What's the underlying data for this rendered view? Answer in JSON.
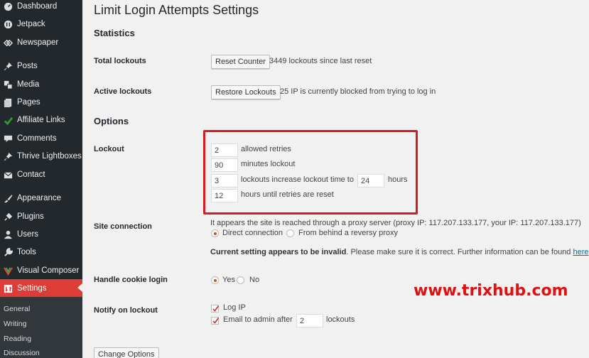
{
  "sidebar": {
    "items": [
      {
        "label": "Dashboard",
        "icon": "dashboard-icon"
      },
      {
        "label": "Jetpack",
        "icon": "jetpack-icon"
      },
      {
        "label": "Newspaper",
        "icon": "newspaper-icon"
      },
      {
        "label": "Posts",
        "icon": "pin-icon"
      },
      {
        "label": "Media",
        "icon": "media-icon"
      },
      {
        "label": "Pages",
        "icon": "pages-icon"
      },
      {
        "label": "Affiliate Links",
        "icon": "affiliate-icon"
      },
      {
        "label": "Comments",
        "icon": "comment-icon"
      },
      {
        "label": "Thrive Lightboxes",
        "icon": "pin-icon"
      },
      {
        "label": "Contact",
        "icon": "envelope-icon"
      },
      {
        "label": "Appearance",
        "icon": "paintbrush-icon"
      },
      {
        "label": "Plugins",
        "icon": "plug-icon"
      },
      {
        "label": "Users",
        "icon": "user-icon"
      },
      {
        "label": "Tools",
        "icon": "wrench-icon"
      },
      {
        "label": "Visual Composer",
        "icon": "visual-composer-icon"
      },
      {
        "label": "Settings",
        "icon": "settings-icon",
        "active": true
      }
    ],
    "submenu": [
      "General",
      "Writing",
      "Reading",
      "Discussion"
    ],
    "active_color": "#dd3d36"
  },
  "page": {
    "title": "Limit Login Attempts Settings",
    "statistics_heading": "Statistics",
    "options_heading": "Options"
  },
  "statistics": {
    "total_lockouts_label": "Total lockouts",
    "reset_button": "Reset Counter",
    "total_lockouts_text": "3449 lockouts since last reset",
    "active_lockouts_label": "Active lockouts",
    "restore_button": "Restore Lockouts",
    "active_lockouts_text": "25 IP is currently blocked from trying to log in"
  },
  "lockout": {
    "label": "Lockout",
    "allowed_retries": "2",
    "allowed_retries_text": "allowed retries",
    "minutes_lockout": "90",
    "minutes_lockout_text": "minutes lockout",
    "lockouts_increase": "3",
    "lockouts_increase_text": "lockouts increase lockout time to",
    "increase_hours": "24",
    "hours_text": "hours",
    "reset_hours": "12",
    "reset_hours_text": "hours until retries are reset",
    "highlight_color": "#d71920"
  },
  "site_connection": {
    "label": "Site connection",
    "info": "It appears the site is reached through a proxy server (proxy IP: 117.207.133.177, your IP: 117.207.133.177)",
    "option_direct": "Direct connection",
    "option_proxy": "From behind a reversy proxy",
    "selected": "Direct connection",
    "warning_bold": "Current setting appears to be invalid",
    "warning_rest": ". Please make sure it is correct. Further information can be found ",
    "link_text": "here"
  },
  "cookie": {
    "label": "Handle cookie login",
    "yes": "Yes",
    "no": "No",
    "selected": "Yes"
  },
  "notify": {
    "label": "Notify on lockout",
    "log_ip": "Log IP",
    "log_ip_checked": true,
    "email_text": "Email to admin after",
    "email_checked": true,
    "email_count": "2",
    "lockouts_text": "lockouts"
  },
  "footer": {
    "change_button": "Change Options"
  },
  "watermark": "www.trixhub.com"
}
